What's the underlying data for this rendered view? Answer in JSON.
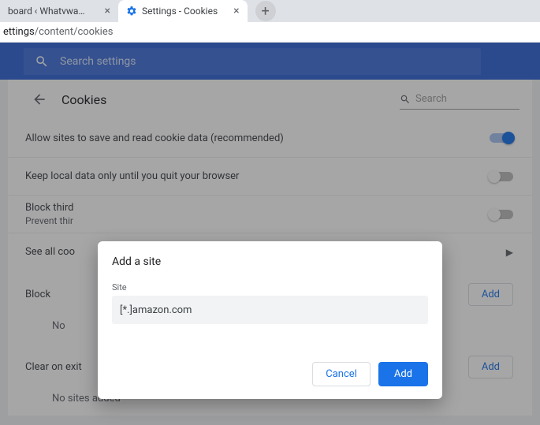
{
  "tabs": {
    "inactive_title": "board ‹ Whatvwant — Wor…",
    "active_title": "Settings - Cookies"
  },
  "address": {
    "host": "ettings",
    "path": "/content/cookies"
  },
  "header": {
    "search_placeholder": "Search settings"
  },
  "page": {
    "title": "Cookies",
    "search_placeholder": "Search"
  },
  "rows": {
    "allow": "Allow sites to save and read cookie data (recommended)",
    "keep_local": "Keep local data only until you quit your browser",
    "third_party_label": "Block third",
    "third_party_sub": "Prevent thir",
    "see_all": "See all coo"
  },
  "sections": {
    "block": {
      "title": "Block",
      "add": "Add",
      "empty": "No"
    },
    "clear": {
      "title": "Clear on exit",
      "add": "Add",
      "empty": "No sites added"
    }
  },
  "dialog": {
    "title": "Add a site",
    "label": "Site",
    "input_value": "[*.]amazon.com",
    "cancel": "Cancel",
    "add": "Add"
  }
}
